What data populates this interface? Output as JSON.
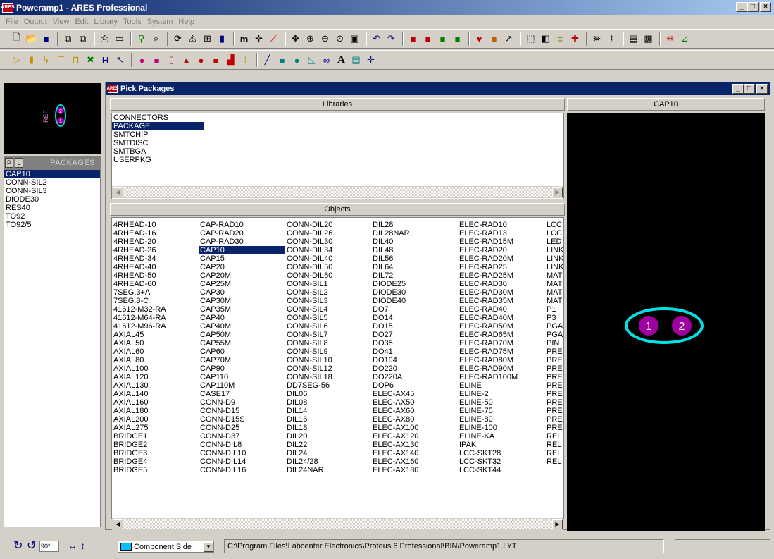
{
  "window": {
    "title": "Poweramp1 - ARES Professional",
    "app_icon": "ARES"
  },
  "menu": [
    "File",
    "Output",
    "View",
    "Edit",
    "Library",
    "Tools",
    "System",
    "Help"
  ],
  "toolbar1_icons": [
    "new-icon",
    "open-icon",
    "save-icon",
    "import-icon",
    "export-icon",
    "print-icon",
    "print-area-icon",
    "netlist-icon",
    "design-explorer-icon",
    "refresh-icon",
    "flip-icon",
    "grid-icon",
    "layers-icon",
    "metric-icon",
    "origin-icon",
    "snap-icon",
    "pan-icon",
    "zoom-in-icon",
    "zoom-out-icon",
    "zoom-area-icon",
    "zoom-all-icon",
    "undo-icon",
    "redo-icon",
    "block-copy-icon",
    "block-move-icon",
    "block-rotate-icon",
    "block-delete-icon",
    "pick-icon",
    "make-package-icon",
    "decompose-icon",
    "autoroute-icon",
    "tidy-icon",
    "ratsnest-icon",
    "connectivity-icon",
    "search-icon",
    "tag-icon",
    "drc-icon",
    "layer-icon",
    "power-plane-icon",
    "3d-icon"
  ],
  "toolbar2_icons": [
    "selection-icon",
    "component-icon",
    "track-icon",
    "via-icon",
    "zone-icon",
    "ratsnest-mode-icon",
    "connectivity-highlight-icon",
    "round-pad-icon",
    "square-pad-icon",
    "dil-pad-icon",
    "edge-pad-icon",
    "circle-smt-icon",
    "rect-smt-icon",
    "polygon-pad-icon",
    "padstack-icon",
    "line-icon",
    "box-icon",
    "circle-icon",
    "arc-icon",
    "path-icon",
    "text-icon",
    "symbol-icon",
    "marker-icon"
  ],
  "left_panel": {
    "tabs": [
      "P",
      "L"
    ],
    "header": "PACKAGES",
    "items": [
      "CAP10",
      "CONN-SIL2",
      "CONN-SIL3",
      "DIODE30",
      "RES40",
      "TO92",
      "TO92/5"
    ],
    "selected": "CAP10",
    "preview_ref": "REF",
    "preview_pins": [
      "2",
      "1"
    ]
  },
  "dialog": {
    "title": "Pick Packages",
    "libraries_header": "Libraries",
    "libraries": [
      "CONNECTORS",
      "PACKAGE",
      "SMTCHIP",
      "SMTDISC",
      "SMTBGA",
      "USERPKG"
    ],
    "selected_library": "PACKAGE",
    "objects_header": "Objects",
    "preview_header": "CAP10",
    "preview_pins": [
      "1",
      "2"
    ],
    "selected_object": "CAP10",
    "objects": [
      [
        "4RHEAD-10",
        "4RHEAD-16",
        "4RHEAD-20",
        "4RHEAD-26",
        "4RHEAD-34",
        "4RHEAD-40",
        "4RHEAD-50",
        "4RHEAD-60",
        "7SEG.3+A",
        "7SEG.3-C",
        "41612-M32-RA",
        "41612-M64-RA",
        "41612-M96-RA",
        "AXIAL45",
        "AXIAL50",
        "AXIAL60",
        "AXIAL80",
        "AXIAL100",
        "AXIAL120",
        "AXIAL130",
        "AXIAL140",
        "AXIAL160",
        "AXIAL180",
        "AXIAL200",
        "AXIAL275",
        "BRIDGE1",
        "BRIDGE2",
        "BRIDGE3",
        "BRIDGE4",
        "BRIDGE5"
      ],
      [
        "CAP-RAD10",
        "CAP-RAD20",
        "CAP-RAD30",
        "CAP10",
        "CAP15",
        "CAP20",
        "CAP20M",
        "CAP25M",
        "CAP30",
        "CAP30M",
        "CAP35M",
        "CAP40",
        "CAP40M",
        "CAP50M",
        "CAP55M",
        "CAP60",
        "CAP70M",
        "CAP90",
        "CAP110",
        "CAP110M",
        "CASE17",
        "CONN-D9",
        "CONN-D15",
        "CONN-D15S",
        "CONN-D25",
        "CONN-D37",
        "CONN-DIL8",
        "CONN-DIL10",
        "CONN-DIL14",
        "CONN-DIL16"
      ],
      [
        "CONN-DIL20",
        "CONN-DIL26",
        "CONN-DIL30",
        "CONN-DIL34",
        "CONN-DIL40",
        "CONN-DIL50",
        "CONN-DIL60",
        "CONN-SIL1",
        "CONN-SIL2",
        "CONN-SIL3",
        "CONN-SIL4",
        "CONN-SIL5",
        "CONN-SIL6",
        "CONN-SIL7",
        "CONN-SIL8",
        "CONN-SIL9",
        "CONN-SIL10",
        "CONN-SIL12",
        "CONN-SIL18",
        "DD7SEG-56",
        "DIL06",
        "DIL08",
        "DIL14",
        "DIL16",
        "DIL18",
        "DIL20",
        "DIL22",
        "DIL24",
        "DIL24/28",
        "DIL24NAR"
      ],
      [
        "DIL28",
        "DIL28NAR",
        "DIL40",
        "DIL48",
        "DIL56",
        "DIL64",
        "DIL72",
        "DIODE25",
        "DIODE30",
        "DIODE40",
        "DO7",
        "DO14",
        "DO15",
        "DO27",
        "DO35",
        "DO41",
        "DO194",
        "DO220",
        "DO220A",
        "DOP6",
        "ELEC-AX45",
        "ELEC-AX50",
        "ELEC-AX60",
        "ELEC-AX80",
        "ELEC-AX100",
        "ELEC-AX120",
        "ELEC-AX130",
        "ELEC-AX140",
        "ELEC-AX160",
        "ELEC-AX180"
      ],
      [
        "ELEC-RAD10",
        "ELEC-RAD13",
        "ELEC-RAD15M",
        "ELEC-RAD20",
        "ELEC-RAD20M",
        "ELEC-RAD25",
        "ELEC-RAD25M",
        "ELEC-RAD30",
        "ELEC-RAD30M",
        "ELEC-RAD35M",
        "ELEC-RAD40",
        "ELEC-RAD40M",
        "ELEC-RAD50M",
        "ELEC-RAD65M",
        "ELEC-RAD70M",
        "ELEC-RAD75M",
        "ELEC-RAD80M",
        "ELEC-RAD90M",
        "ELEC-RAD100M",
        "ELINE",
        "ELINE-2",
        "ELINE-50",
        "ELINE-75",
        "ELINE-80",
        "ELINE-100",
        "ELINE-KA",
        "IPAK",
        "LCC-SKT28",
        "LCC-SKT32",
        "LCC-SKT44"
      ],
      [
        "LCC",
        "LCC",
        "LED",
        "LINK",
        "LINK",
        "LINK",
        "MAT",
        "MAT",
        "MAT",
        "MAT",
        "P1",
        "P3",
        "PGA",
        "PGA",
        "PIN",
        "PRE",
        "PRE",
        "PRE",
        "PRE",
        "PRE",
        "PRE",
        "PRE",
        "PRE",
        "PRE",
        "PRE",
        "REL",
        "REL",
        "REL",
        "REL"
      ]
    ]
  },
  "status": {
    "rotation": "90°",
    "layer": "Component Side",
    "path": "C:\\Program Files\\Labcenter Electronics\\Proteus 6 Professional\\BIN\\Poweramp1.LYT"
  }
}
